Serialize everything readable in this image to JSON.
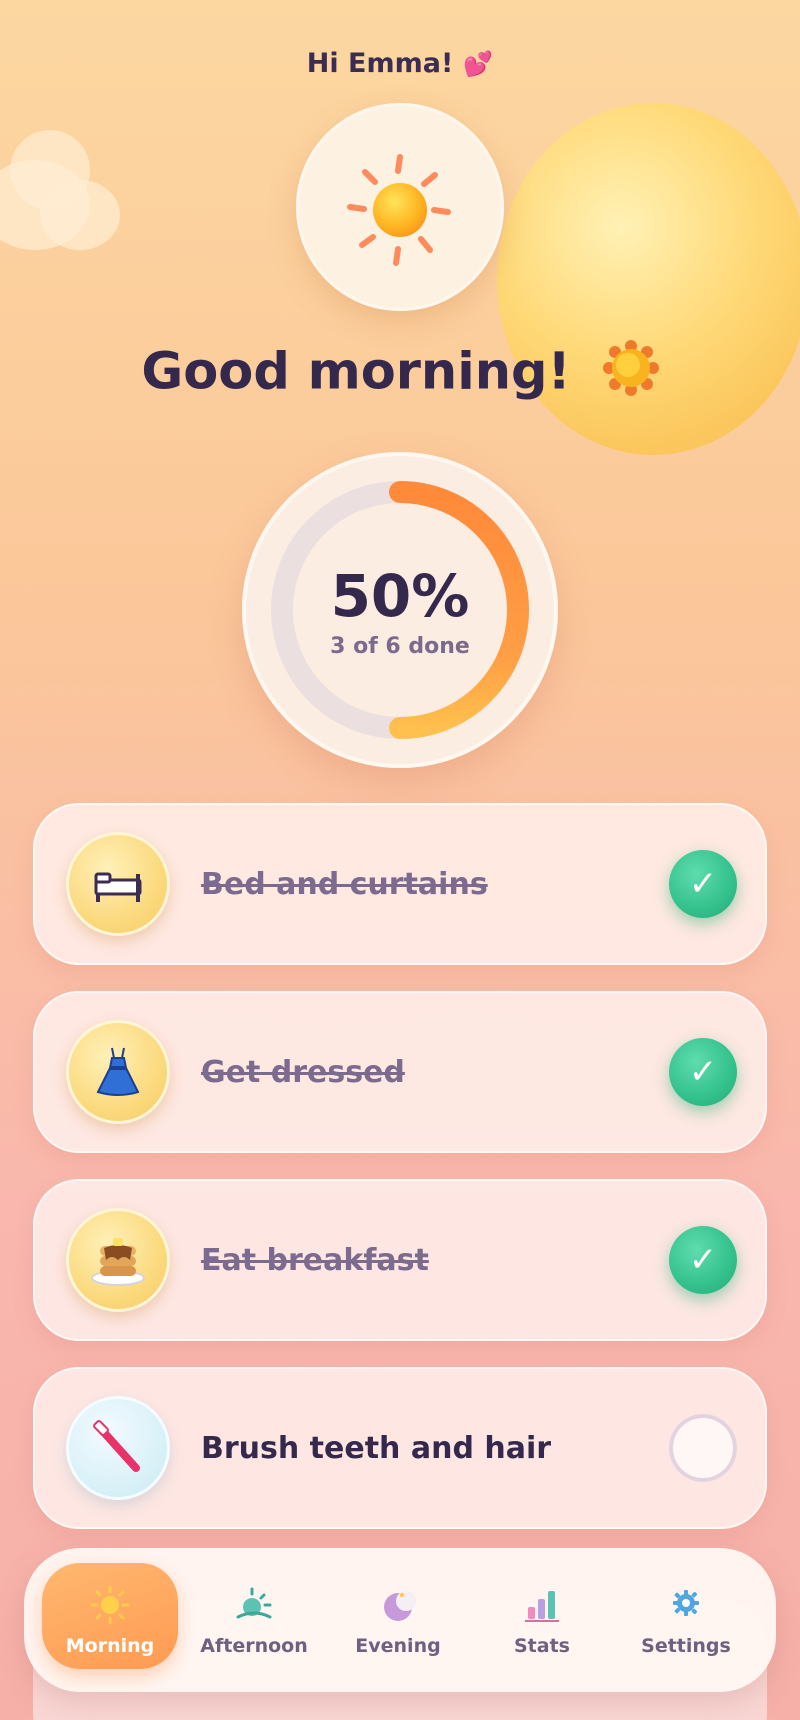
{
  "header": {
    "greeting": "Hi Emma!",
    "greeting_emoji": "💕",
    "title": "Good morning!"
  },
  "progress": {
    "percent_label": "50%",
    "percent": 50,
    "summary": "3 of 6 done"
  },
  "tasks": [
    {
      "label": "Bed and curtains",
      "icon": "bed-icon",
      "done": true
    },
    {
      "label": "Get dressed",
      "icon": "dress-icon",
      "done": true
    },
    {
      "label": "Eat breakfast",
      "icon": "pancakes-icon",
      "done": true
    },
    {
      "label": "Brush teeth and hair",
      "icon": "toothbrush-icon",
      "done": false
    }
  ],
  "check_mark": "✓",
  "nav": {
    "items": [
      {
        "label": "Morning",
        "icon": "sun-icon",
        "active": true
      },
      {
        "label": "Afternoon",
        "icon": "sunset-icon",
        "active": false
      },
      {
        "label": "Evening",
        "icon": "moon-icon",
        "active": false
      },
      {
        "label": "Stats",
        "icon": "bar-chart-icon",
        "active": false
      },
      {
        "label": "Settings",
        "icon": "gear-icon",
        "active": false
      }
    ]
  },
  "colors": {
    "accent_orange": "#ff9a52",
    "check_green": "#33c18c",
    "text_dark": "#35284d"
  }
}
